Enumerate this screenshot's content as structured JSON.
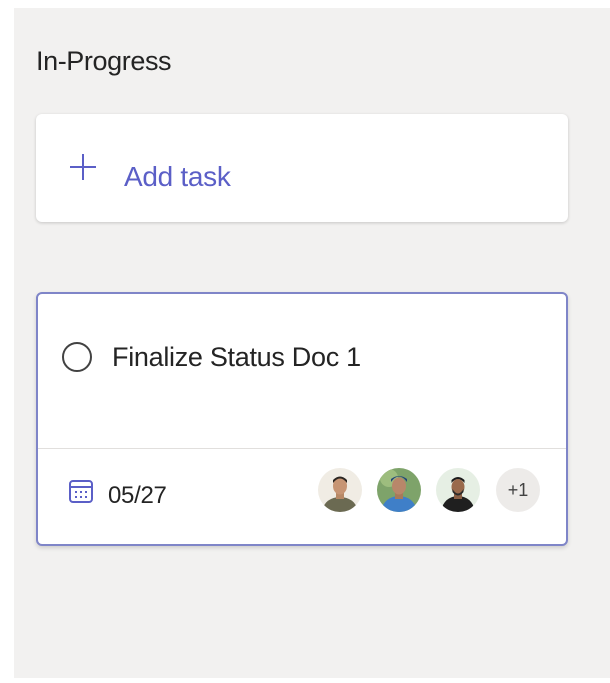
{
  "column": {
    "title": "In-Progress"
  },
  "add_task": {
    "label": "Add task",
    "icon": "plus-icon"
  },
  "task": {
    "title": "Finalize Status Doc 1",
    "due_date": "05/27",
    "due_icon": "calendar-icon",
    "assignees": [
      {
        "icon": "avatar-1"
      },
      {
        "icon": "avatar-2"
      },
      {
        "icon": "avatar-3"
      }
    ],
    "extra_assignees": "+1"
  },
  "colors": {
    "accent": "#5b5fc7",
    "card_border": "#7f85c8",
    "board_background": "#f2f1f0"
  }
}
